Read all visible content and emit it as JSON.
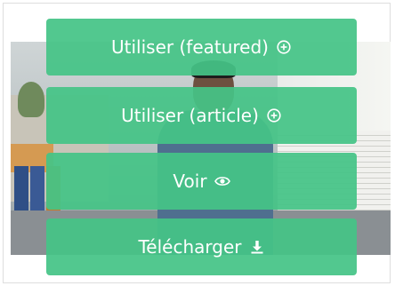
{
  "buttons": {
    "use_featured": {
      "label": "Utiliser (featured)",
      "icon": "plus-circle-icon"
    },
    "use_article": {
      "label": "Utiliser (article)",
      "icon": "plus-circle-icon"
    },
    "view": {
      "label": "Voir",
      "icon": "eye-icon"
    },
    "download": {
      "label": "Télécharger",
      "icon": "download-icon"
    }
  },
  "colors": {
    "button_green": "#45C486",
    "button_text": "#FFFFFF"
  }
}
